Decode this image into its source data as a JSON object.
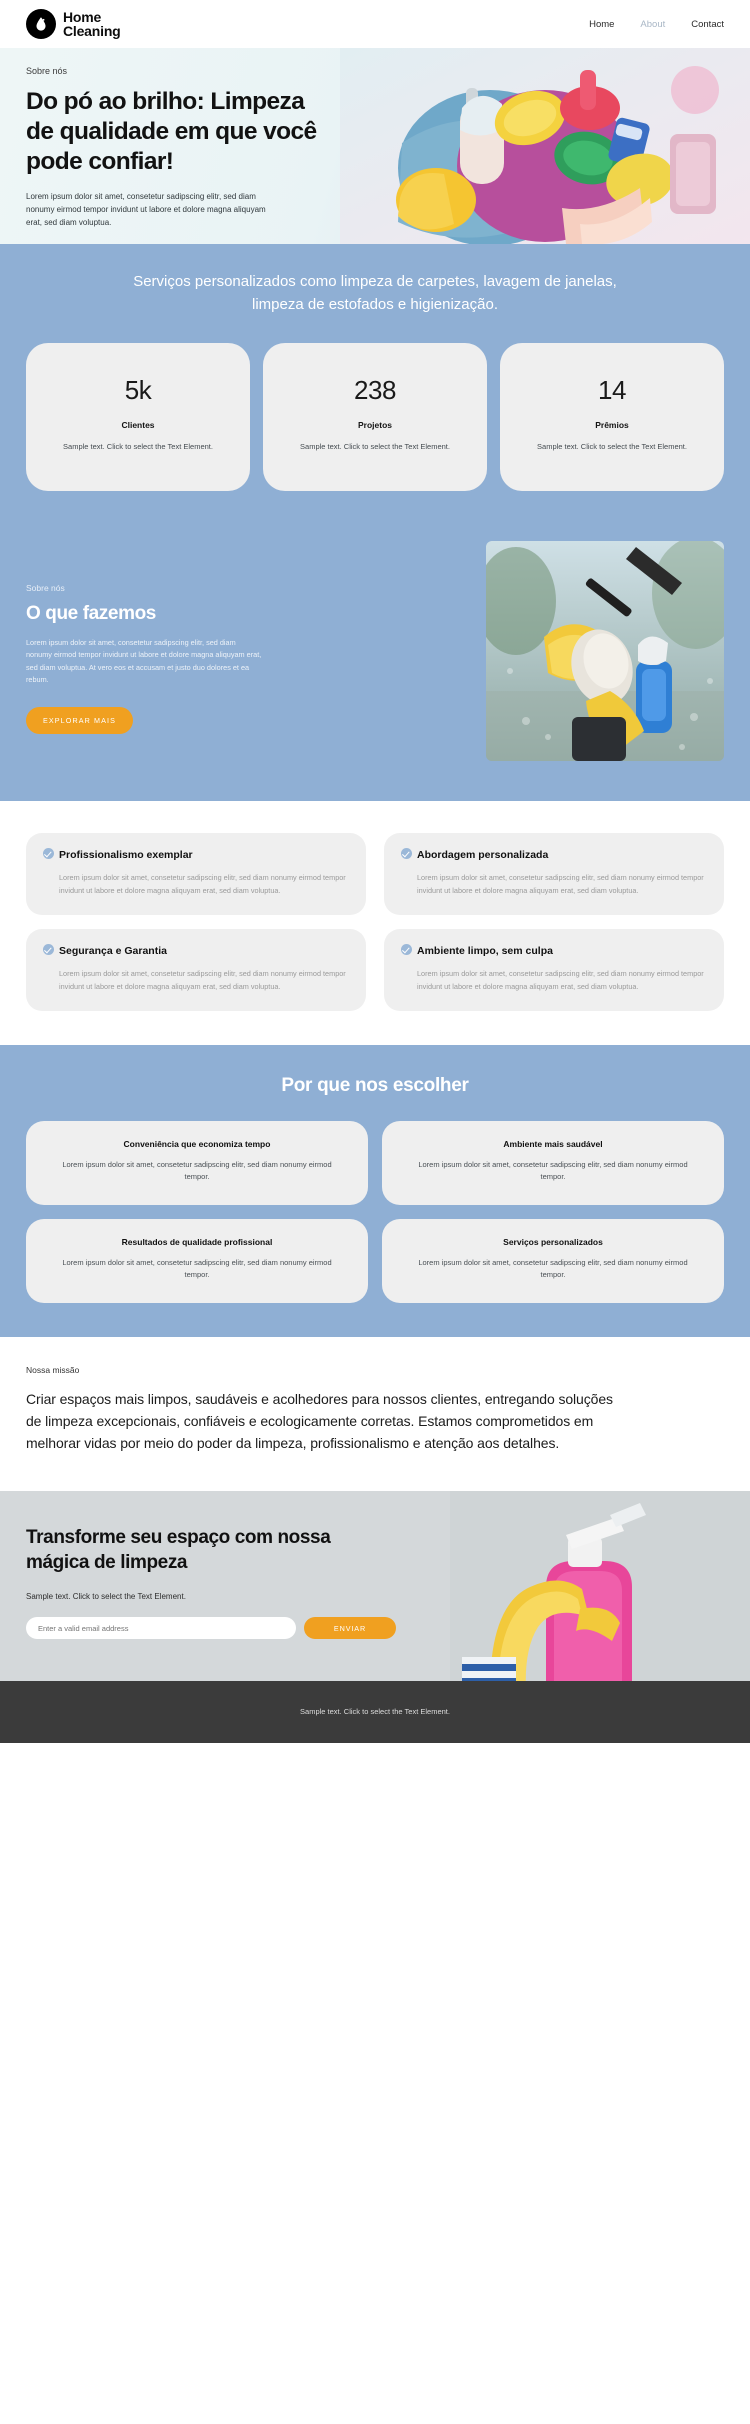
{
  "header": {
    "brand_line1": "Home",
    "brand_line2": "Cleaning",
    "logo_icon": "water-drop-logo-icon",
    "nav": [
      {
        "label": "Home",
        "muted": false
      },
      {
        "label": "About",
        "muted": true
      },
      {
        "label": "Contact",
        "muted": false
      }
    ]
  },
  "hero": {
    "eyebrow": "Sobre nós",
    "title": "Do pó ao brilho: Limpeza de qualidade em que você pode confiar!",
    "paragraph": "Lorem ipsum dolor sit amet, consetetur sadipscing elitr, sed diam nonumy eirmod tempor invidunt ut labore et dolore magna aliquyam erat, sed diam voluptua.",
    "image_alt": "cleaning-supplies-bucket-photo"
  },
  "services_banner": {
    "text": "Serviços personalizados como limpeza de carpetes, lavagem de janelas, limpeza de estofados e higienização."
  },
  "stats": [
    {
      "number": "5k",
      "label": "Clientes",
      "text": "Sample text. Click to select the Text Element."
    },
    {
      "number": "238",
      "label": "Projetos",
      "text": "Sample text. Click to select the Text Element."
    },
    {
      "number": "14",
      "label": "Prêmios",
      "text": "Sample text. Click to select the Text Element."
    }
  ],
  "what_we_do": {
    "eyebrow": "Sobre nós",
    "title": "O que fazemos",
    "paragraph": "Lorem ipsum dolor sit amet, consetetur sadipscing elitr, sed diam nonumy eirmod tempor invidunt ut labore et dolore magna aliquyam erat, sed diam voluptua. At vero eos et accusam et justo duo dolores et ea rebum.",
    "button_label": "EXPLORAR MAIS",
    "image_alt": "window-cleaning-squeegee-photo"
  },
  "features": [
    {
      "icon": "check-circle-icon",
      "title": "Profissionalismo exemplar",
      "text": "Lorem ipsum dolor sit amet, consetetur sadipscing elitr, sed diam nonumy eirmod tempor invidunt ut labore et dolore magna aliquyam erat, sed diam voluptua."
    },
    {
      "icon": "check-circle-icon",
      "title": "Abordagem personalizada",
      "text": "Lorem ipsum dolor sit amet, consetetur sadipscing elitr, sed diam nonumy eirmod tempor invidunt ut labore et dolore magna aliquyam erat, sed diam voluptua."
    },
    {
      "icon": "check-circle-icon",
      "title": "Segurança e Garantia",
      "text": "Lorem ipsum dolor sit amet, consetetur sadipscing elitr, sed diam nonumy eirmod tempor invidunt ut labore et dolore magna aliquyam erat, sed diam voluptua."
    },
    {
      "icon": "check-circle-icon",
      "title": "Ambiente limpo, sem culpa",
      "text": "Lorem ipsum dolor sit amet, consetetur sadipscing elitr, sed diam nonumy eirmod tempor invidunt ut labore et dolore magna aliquyam erat, sed diam voluptua."
    }
  ],
  "why_choose": {
    "title": "Por que nos escolher",
    "cards": [
      {
        "title": "Conveniência que economiza tempo",
        "text": "Lorem ipsum dolor sit amet, consetetur sadipscing elitr, sed diam nonumy eirmod tempor."
      },
      {
        "title": "Ambiente mais saudável",
        "text": "Lorem ipsum dolor sit amet, consetetur sadipscing elitr, sed diam nonumy eirmod tempor."
      },
      {
        "title": "Resultados de qualidade profissional",
        "text": "Lorem ipsum dolor sit amet, consetetur sadipscing elitr, sed diam nonumy eirmod tempor."
      },
      {
        "title": "Serviços personalizados",
        "text": "Lorem ipsum dolor sit amet, consetetur sadipscing elitr, sed diam nonumy eirmod tempor."
      }
    ]
  },
  "mission": {
    "eyebrow": "Nossa missão",
    "text": "Criar espaços mais limpos, saudáveis e acolhedores para nossos clientes, entregando soluções de limpeza excepcionais, confiáveis e ecologicamente corretas. Estamos comprometidos em melhorar vidas por meio do poder da limpeza, profissionalismo e atenção aos detalhes."
  },
  "cta": {
    "title": "Transforme seu espaço com nossa mágica de limpeza",
    "subtitle": "Sample text. Click to select the Text Element.",
    "input_placeholder": "Enter a valid email address",
    "input_value": "",
    "button_label": "ENVIAR",
    "image_alt": "gloved-hand-holding-spray-bottle-photo"
  },
  "footer": {
    "text": "Sample text. Click to select the Text Element."
  },
  "colors": {
    "blue_section": "#8fafd4",
    "accent_orange": "#f0a020",
    "card_gray": "#efefef",
    "footer_dark": "#3b3b3b",
    "check_blue": "#9bb8d8"
  }
}
